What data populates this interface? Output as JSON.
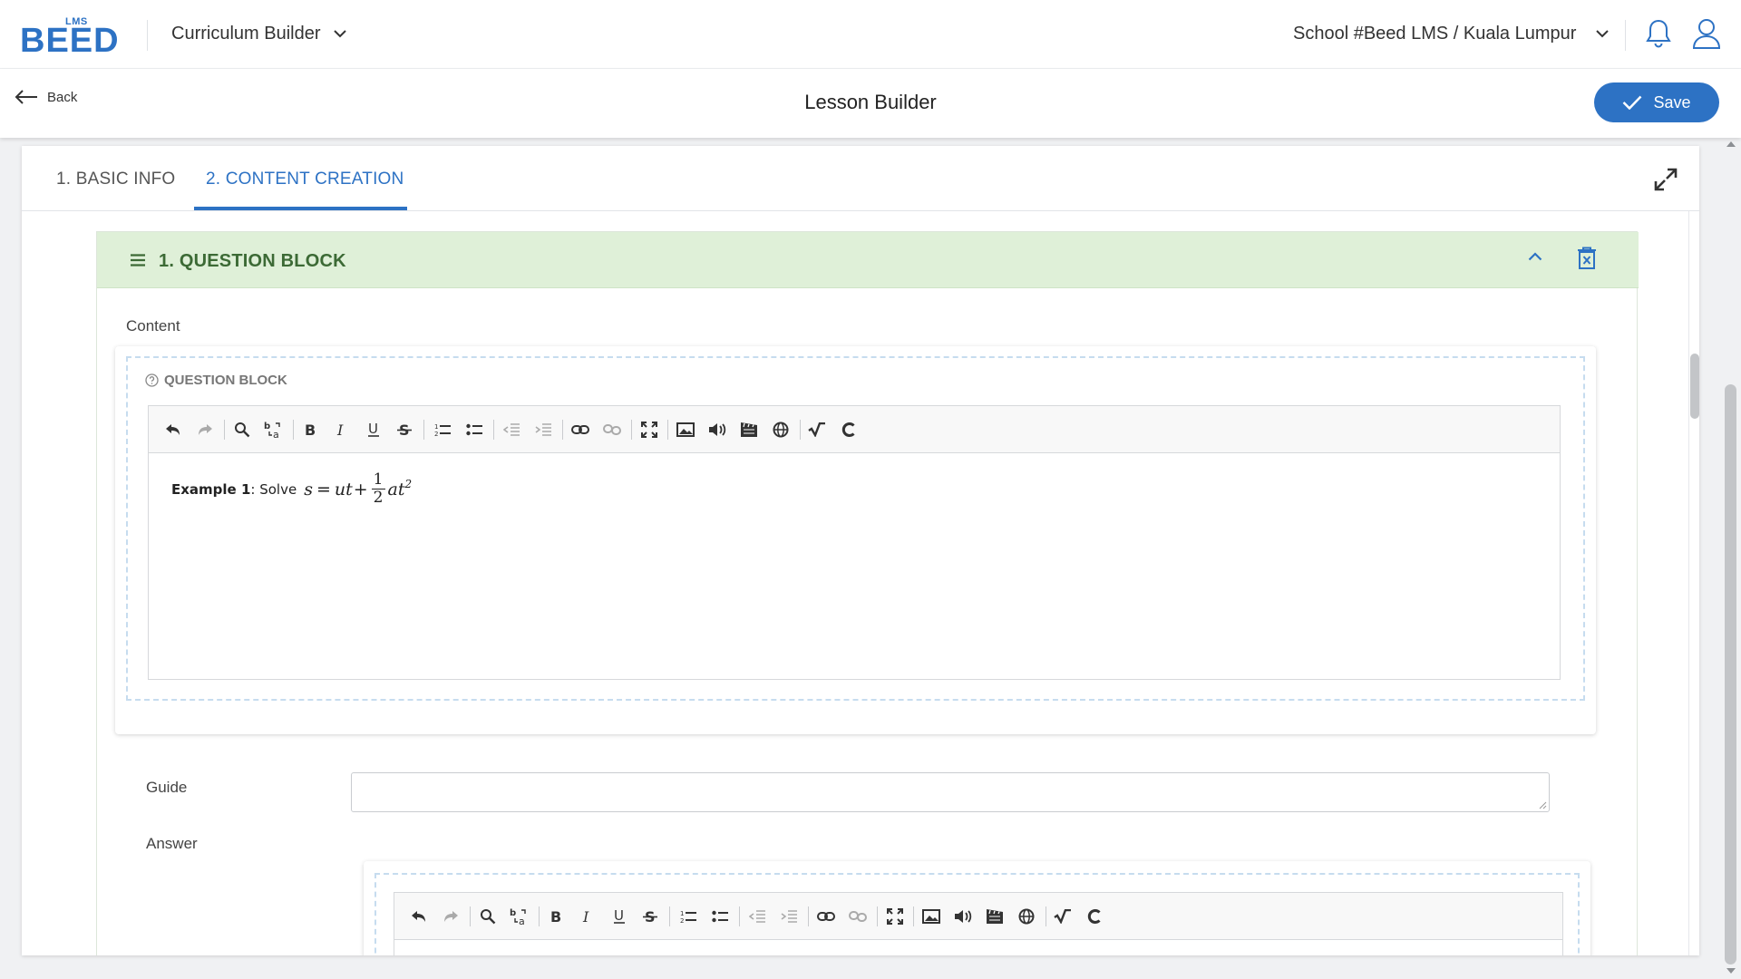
{
  "header": {
    "logo_small": "LMS",
    "logo_word": "BEED",
    "module": "Curriculum Builder",
    "school": "School #Beed LMS / Kuala Lumpur"
  },
  "subheader": {
    "back_label": "Back",
    "title": "Lesson Builder",
    "save_label": "Save"
  },
  "tabs": [
    {
      "label": "1. BASIC INFO",
      "active": false
    },
    {
      "label": "2. CONTENT CREATION",
      "active": true
    }
  ],
  "question_block": {
    "title": "1. QUESTION BLOCK",
    "content_label": "Content",
    "block_label": "QUESTION BLOCK",
    "content": {
      "prefix_bold": "Example 1",
      "prefix_rest": ": Solve",
      "formula": {
        "lhs": "s",
        "eq": "=",
        "term1": "ut",
        "plus": "+",
        "num": "1",
        "den": "2",
        "term2": "at",
        "exp": "2"
      }
    },
    "guide_label": "Guide",
    "guide_value": "",
    "answer_label": "Answer"
  },
  "toolbar_icons": [
    "undo-icon",
    "redo-icon",
    "find-icon",
    "replace-icon",
    "bold-icon",
    "italic-icon",
    "underline-icon",
    "strikethrough-icon",
    "numbered-list-icon",
    "bullet-list-icon",
    "outdent-icon",
    "indent-icon",
    "link-icon",
    "unlink-icon",
    "fullscreen-icon",
    "image-icon",
    "audio-icon",
    "video-icon",
    "embed-globe-icon",
    "math-formula-icon",
    "chemistry-icon"
  ],
  "colors": {
    "primary": "#2d72c4",
    "block_header": "#dff0d8",
    "block_title": "#3c6a35"
  }
}
